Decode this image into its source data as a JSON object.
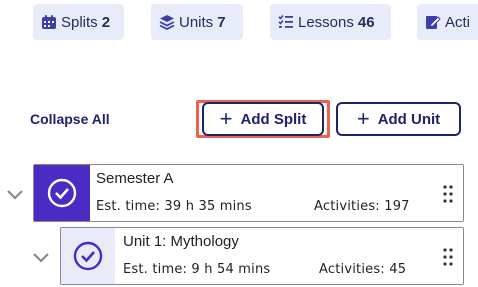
{
  "summary": {
    "splits": {
      "label": "Splits",
      "count": "2"
    },
    "units": {
      "label": "Units",
      "count": "7"
    },
    "lessons": {
      "label": "Lessons",
      "count": "46"
    },
    "activities": {
      "label": "Acti"
    }
  },
  "toolbar": {
    "collapse_all": "Collapse All",
    "add_split": "Add Split",
    "add_unit": "Add Unit"
  },
  "tree": {
    "semester": {
      "title": "Semester A",
      "est_time": "Est. time: 39 h 35 mins",
      "activities": "Activities: 197"
    },
    "unit": {
      "title": "Unit 1: Mythology",
      "est_time": "Est. time: 9 h 54 mins",
      "activities": "Activities: 45"
    }
  },
  "colors": {
    "navy": "#1e236e",
    "purple": "#4a2bc4",
    "pill_bg": "#e7ecf8",
    "highlight": "#f1604d"
  },
  "icons": [
    "calendar-icon",
    "layers-icon",
    "checklist-icon",
    "edit-icon",
    "chevron-down-icon",
    "check-circle-icon",
    "drag-handle-icon"
  ]
}
